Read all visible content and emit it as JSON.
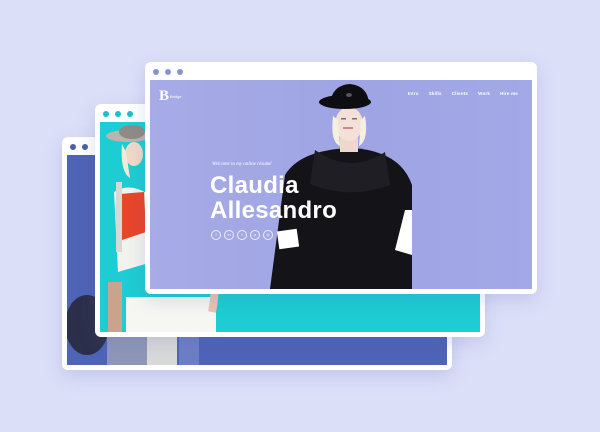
{
  "colors": {
    "background": "#dcdff8",
    "front_screen": "#a3a9e7",
    "middle_screen": "#1ccdd3",
    "back_screen": "#5066b8"
  },
  "front": {
    "logo_letter": "B",
    "logo_sub": "Bridge",
    "nav": [
      "Intro",
      "Skills",
      "Clients",
      "Work",
      "Hire me"
    ],
    "welcome": "Welcome to my online résumé",
    "name_line1": "Claudia",
    "name_line2": "Allesandro",
    "social_icons": [
      "facebook-icon",
      "linkedin-icon",
      "twitter-icon",
      "pinterest-icon",
      "instagram-icon"
    ],
    "social_glyphs": [
      "f",
      "in",
      "t",
      "p",
      "◎"
    ]
  }
}
